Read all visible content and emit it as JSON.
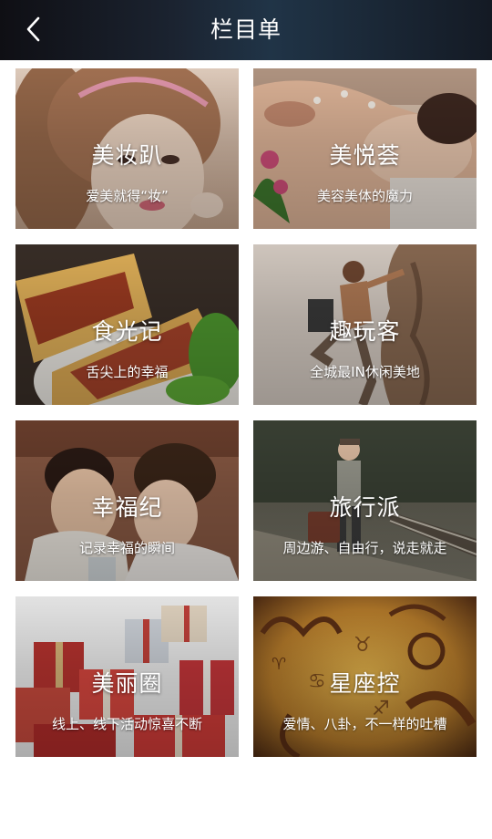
{
  "header": {
    "title": "栏目单",
    "back_icon": "chevron-left-icon"
  },
  "cards": [
    {
      "name": "美妆趴",
      "subtitle": "爱美就得“妆”"
    },
    {
      "name": "美悦荟",
      "subtitle": "美容美体的魔力"
    },
    {
      "name": "食光记",
      "subtitle": "舌尖上的幸福"
    },
    {
      "name": "趣玩客",
      "subtitle": "全城最IN休闲美地"
    },
    {
      "name": "幸福纪",
      "subtitle": "记录幸福的瞬间"
    },
    {
      "name": "旅行派",
      "subtitle": "周边游、自由行，说走就走"
    },
    {
      "name": "美丽圈",
      "subtitle": "线上、线下活动惊喜不断"
    },
    {
      "name": "星座控",
      "subtitle": "爱情、八卦，不一样的吐槽"
    }
  ],
  "colors": {
    "header_bg": "#1b2330",
    "card_text": "#ffffff"
  }
}
